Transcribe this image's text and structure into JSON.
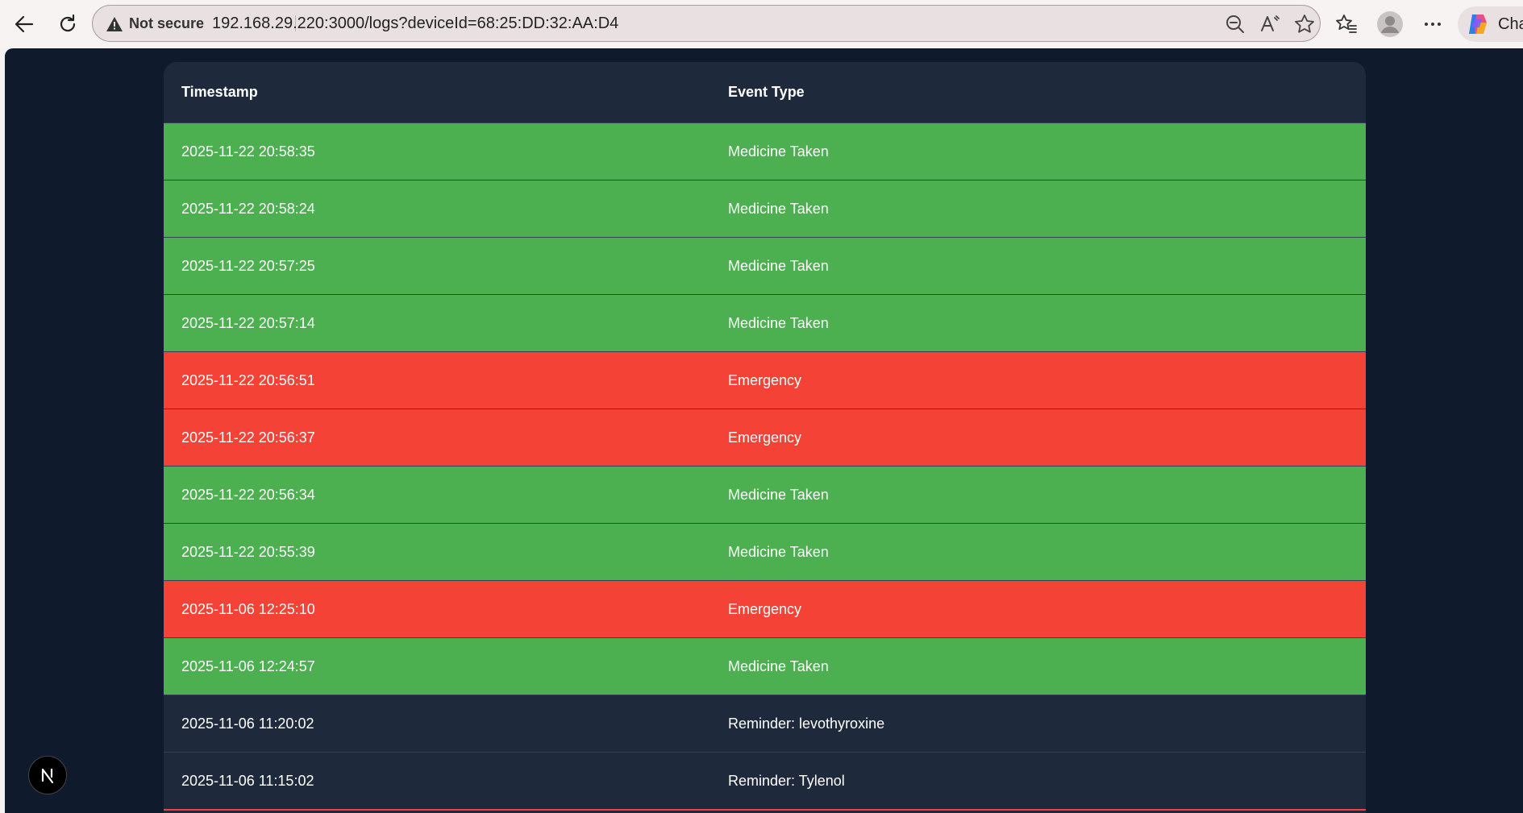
{
  "browser": {
    "security_label": "Not secure",
    "url": "192.168.29.220:3000/logs?deviceId=68:25:DD:32:AA:D4",
    "copilot_label": "Cha"
  },
  "table": {
    "headers": {
      "timestamp": "Timestamp",
      "event_type": "Event Type"
    },
    "rows": [
      {
        "timestamp": "2025-11-22 20:58:35",
        "event": "Medicine Taken",
        "kind": "medicine"
      },
      {
        "timestamp": "2025-11-22 20:58:24",
        "event": "Medicine Taken",
        "kind": "medicine"
      },
      {
        "timestamp": "2025-11-22 20:57:25",
        "event": "Medicine Taken",
        "kind": "medicine"
      },
      {
        "timestamp": "2025-11-22 20:57:14",
        "event": "Medicine Taken",
        "kind": "medicine"
      },
      {
        "timestamp": "2025-11-22 20:56:51",
        "event": "Emergency",
        "kind": "emergency"
      },
      {
        "timestamp": "2025-11-22 20:56:37",
        "event": "Emergency",
        "kind": "emergency"
      },
      {
        "timestamp": "2025-11-22 20:56:34",
        "event": "Medicine Taken",
        "kind": "medicine"
      },
      {
        "timestamp": "2025-11-22 20:55:39",
        "event": "Medicine Taken",
        "kind": "medicine"
      },
      {
        "timestamp": "2025-11-06 12:25:10",
        "event": "Emergency",
        "kind": "emergency"
      },
      {
        "timestamp": "2025-11-06 12:24:57",
        "event": "Medicine Taken",
        "kind": "medicine"
      },
      {
        "timestamp": "2025-11-06 11:20:02",
        "event": "Reminder: levothyroxine",
        "kind": "reminder"
      },
      {
        "timestamp": "2025-11-06 11:15:02",
        "event": "Reminder: Tylenol",
        "kind": "reminder"
      }
    ]
  },
  "colors": {
    "page_background": "#0f1b2d",
    "table_header": "#1e293b",
    "medicine_taken": "#4caf50",
    "emergency": "#f44336",
    "reminder": "#1e293b"
  },
  "icons": {
    "back": "back-arrow-icon",
    "refresh": "refresh-icon",
    "security": "warning-triangle-icon",
    "zoom": "zoom-out-icon",
    "read_aloud": "read-aloud-icon",
    "favorite": "star-icon",
    "favorites_list": "favorites-icon",
    "profile": "profile-icon",
    "more": "more-icon",
    "copilot": "copilot-icon",
    "next_badge": "nextjs-logo-icon"
  }
}
